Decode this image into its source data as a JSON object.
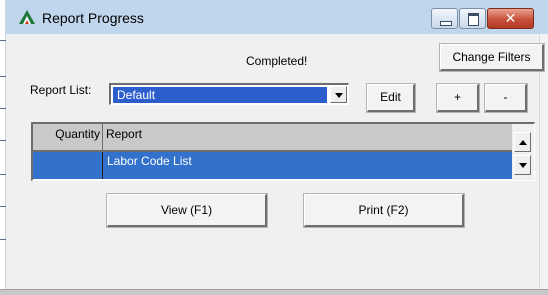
{
  "window": {
    "title": "Report Progress",
    "icon": "triangle-logo-icon",
    "controls": {
      "minimize": "minimize-icon",
      "maximize": "maximize-icon",
      "close": "close-icon",
      "close_glyph": "✕"
    }
  },
  "status_text": "Completed!",
  "buttons": {
    "change_filters": "Change Filters",
    "edit": "Edit",
    "add": "+",
    "remove": "-",
    "view": "View (F1)",
    "print": "Print (F2)"
  },
  "report_list": {
    "label": "Report List:",
    "selected": "Default"
  },
  "grid": {
    "columns": [
      "Quantity",
      "Report"
    ],
    "rows": [
      {
        "quantity": "",
        "report": "Labor Code List",
        "selected": true
      }
    ]
  },
  "colors": {
    "title_bar": "#bfd6ec",
    "selection": "#3272cc",
    "combo_selection": "#2d5fcc",
    "close_button": "#c9503a"
  }
}
